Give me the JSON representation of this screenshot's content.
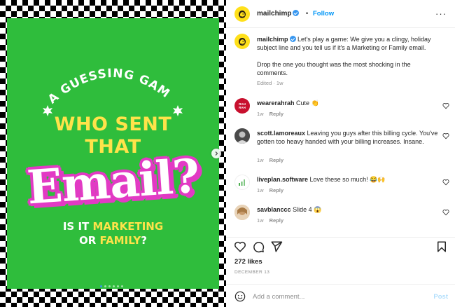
{
  "post_image": {
    "arc_text": "A GUESSING GAME",
    "headline_line1": "WHO SENT",
    "headline_line2": "THAT",
    "headline_big": "Email?",
    "question_prefix": "IS IT ",
    "question_marketing": "MARKETING",
    "question_or": "OR ",
    "question_family": "FAMILY",
    "question_end": "?",
    "carousel_dots": 6,
    "active_dot": 0
  },
  "header": {
    "username": "mailchimp",
    "separator": "•",
    "follow_label": "Follow",
    "more_label": "···"
  },
  "caption": {
    "username": "mailchimp",
    "text": "Let's play a game: We give you a clingy, holiday subject line and you tell us if it's a Marketing or Family email.",
    "text2": "Drop the one you thought was the most shocking in the comments.",
    "meta": "Edited · 1w"
  },
  "comments": [
    {
      "username": "wearerahrah",
      "text": "Cute 👏",
      "time": "1w",
      "reply": "Reply",
      "avatar_text": "RAH RAH"
    },
    {
      "username": "scott.lamoreaux",
      "text": "Leaving you guys after this billing cycle. You've gotten too heavy handed with your billing increases. Insane.",
      "time": "1w",
      "reply": "Reply"
    },
    {
      "username": "liveplan.software",
      "text": "Love these so much! 😂🙌",
      "time": "1w",
      "reply": "Reply"
    },
    {
      "username": "savblanccc",
      "text": "Slide 4 😱",
      "time": "1w",
      "reply": "Reply"
    }
  ],
  "likes": "272 likes",
  "date": "DECEMBER 13",
  "add_comment": {
    "placeholder": "Add a comment...",
    "post_label": "Post"
  },
  "colors": {
    "image_green": "#2fbd3c",
    "headline_yellow": "#ffe34a",
    "email_pink": "#e23ac4",
    "brand_yellow": "#ffe01b",
    "link_blue": "#0095f6"
  }
}
